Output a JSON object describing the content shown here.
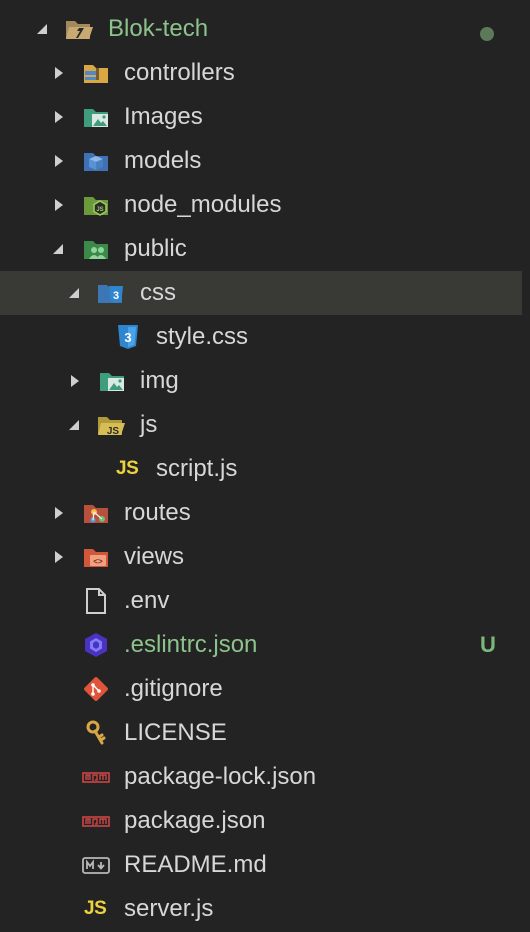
{
  "explorer": {
    "root": {
      "label": "Blok-tech",
      "icon": "folder-open-root-icon"
    },
    "items": [
      {
        "label": "controllers",
        "icon": "folder-controllers-icon",
        "expanded": false
      },
      {
        "label": "Images",
        "icon": "folder-images-icon",
        "expanded": false
      },
      {
        "label": "models",
        "icon": "folder-models-icon",
        "expanded": false
      },
      {
        "label": "node_modules",
        "icon": "folder-node-icon",
        "expanded": false
      },
      {
        "label": "public",
        "icon": "folder-public-icon",
        "expanded": true
      },
      {
        "label": "css",
        "icon": "folder-css-icon",
        "expanded": true,
        "selected": true
      },
      {
        "label": "style.css",
        "icon": "css-file-icon"
      },
      {
        "label": "img",
        "icon": "folder-images-icon",
        "expanded": false
      },
      {
        "label": "js",
        "icon": "folder-js-icon",
        "expanded": true
      },
      {
        "label": "script.js",
        "icon": "js-file-icon"
      },
      {
        "label": "routes",
        "icon": "folder-routes-icon",
        "expanded": false
      },
      {
        "label": "views",
        "icon": "folder-views-icon",
        "expanded": false
      },
      {
        "label": ".env",
        "icon": "file-icon"
      },
      {
        "label": ".eslintrc.json",
        "icon": "eslint-icon",
        "git_status": "U"
      },
      {
        "label": ".gitignore",
        "icon": "git-icon"
      },
      {
        "label": "LICENSE",
        "icon": "license-key-icon"
      },
      {
        "label": "package-lock.json",
        "icon": "npm-icon"
      },
      {
        "label": "package.json",
        "icon": "npm-icon"
      },
      {
        "label": "README.md",
        "icon": "markdown-icon"
      },
      {
        "label": "server.js",
        "icon": "js-file-icon"
      }
    ],
    "js_glyph": "JS",
    "colors": {
      "background": "#232323",
      "selected_row": "#393936",
      "text": "#d7d7d7",
      "untracked_green": "#8cc38c",
      "js_yellow": "#ecd23e"
    }
  }
}
